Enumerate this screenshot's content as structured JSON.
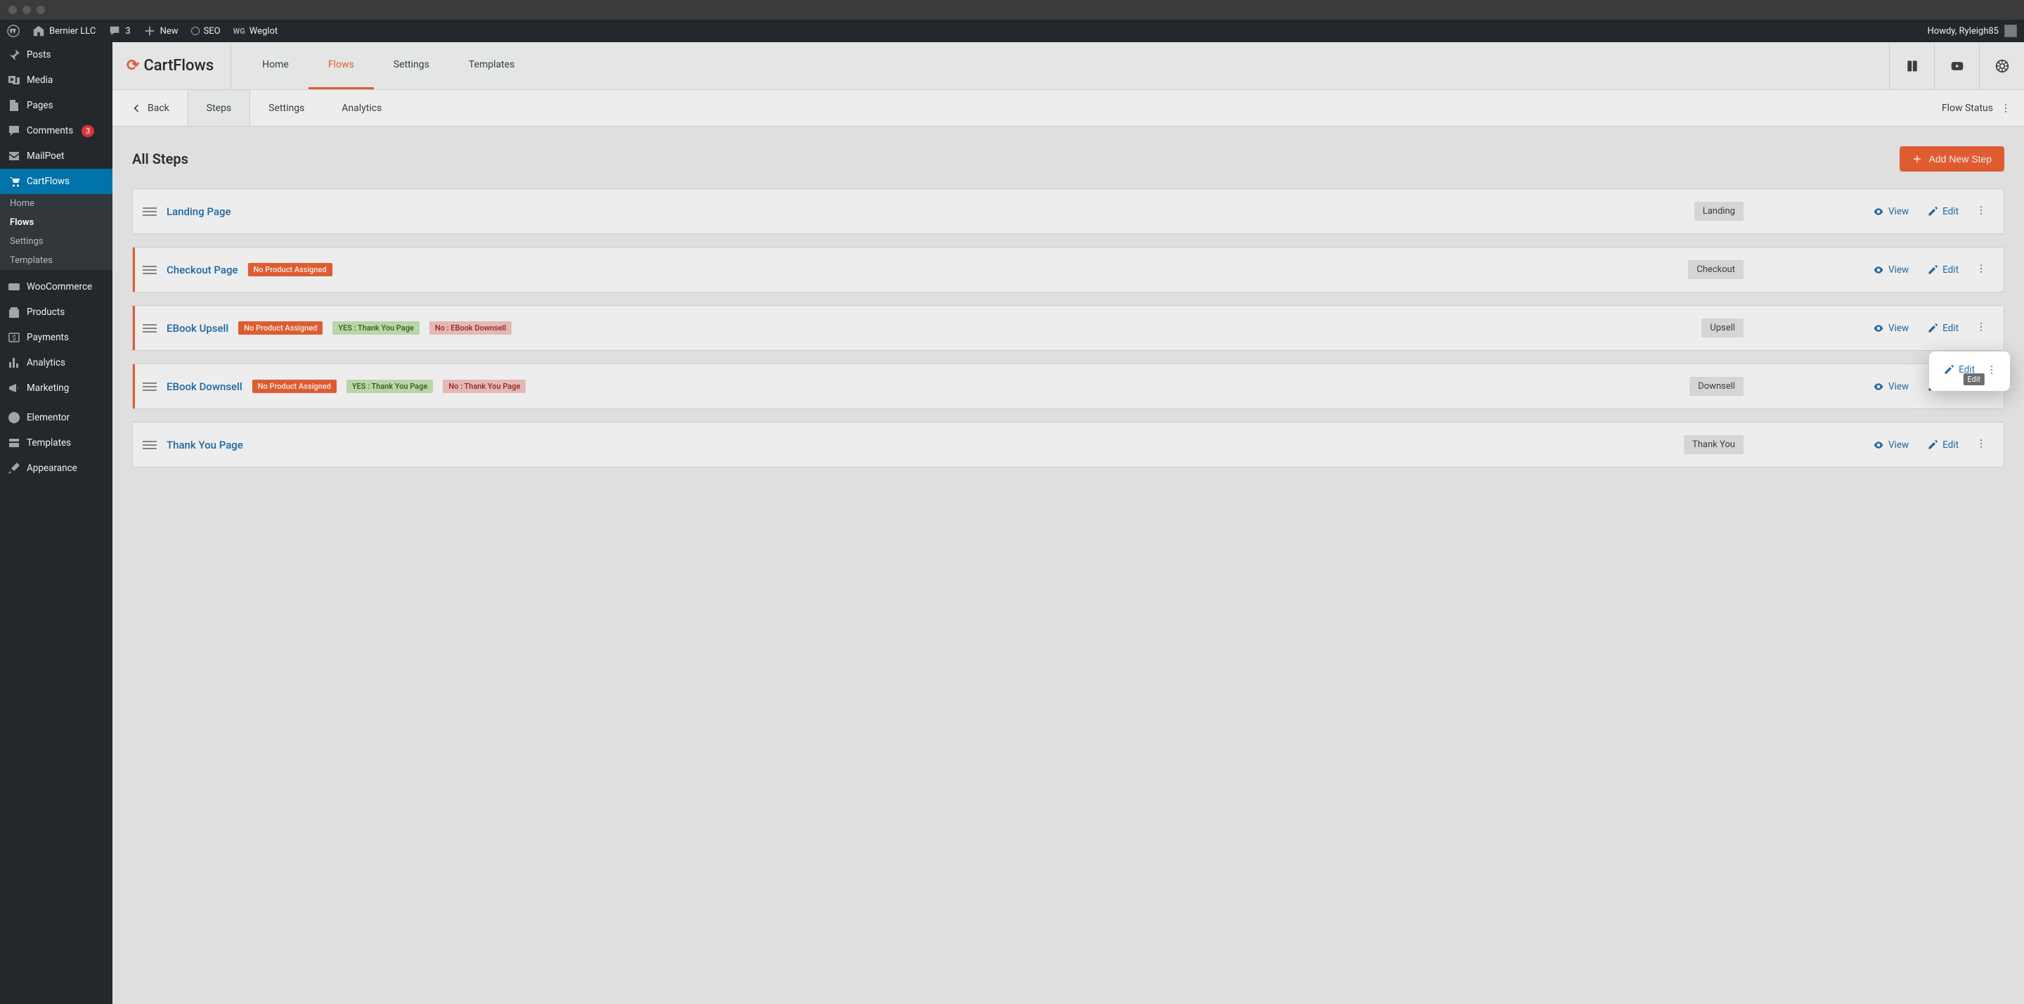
{
  "adminbar": {
    "site_name": "Bernier LLC",
    "comment_count": "3",
    "new_label": "New",
    "seo_label": "SEO",
    "weglot_label": "Weglot",
    "howdy": "Howdy, Ryleigh85"
  },
  "sidebar": {
    "items": [
      {
        "label": "Posts"
      },
      {
        "label": "Media"
      },
      {
        "label": "Pages"
      },
      {
        "label": "Comments",
        "badge": "3"
      },
      {
        "label": "MailPoet"
      },
      {
        "label": "CartFlows"
      },
      {
        "label": "WooCommerce"
      },
      {
        "label": "Products"
      },
      {
        "label": "Payments"
      },
      {
        "label": "Analytics"
      },
      {
        "label": "Marketing"
      },
      {
        "label": "Elementor"
      },
      {
        "label": "Templates"
      },
      {
        "label": "Appearance"
      }
    ],
    "submenu": [
      {
        "label": "Home"
      },
      {
        "label": "Flows"
      },
      {
        "label": "Settings"
      },
      {
        "label": "Templates"
      }
    ]
  },
  "topnav": {
    "brand": "CartFlows",
    "tabs": [
      {
        "label": "Home"
      },
      {
        "label": "Flows"
      },
      {
        "label": "Settings"
      },
      {
        "label": "Templates"
      }
    ]
  },
  "subnav": {
    "back_label": "Back",
    "tabs": [
      {
        "label": "Steps"
      },
      {
        "label": "Settings"
      },
      {
        "label": "Analytics"
      }
    ],
    "flow_status_label": "Flow Status"
  },
  "content": {
    "page_title": "All Steps",
    "add_step_label": "Add New Step",
    "view_label": "View",
    "edit_label": "Edit",
    "tooltip_edit": "Edit"
  },
  "steps": [
    {
      "name": "Landing Page",
      "chip": "Landing",
      "accent": false,
      "tags": []
    },
    {
      "name": "Checkout Page",
      "chip": "Checkout",
      "accent": true,
      "tags": [
        {
          "text": "No Product Assigned",
          "kind": "orange"
        }
      ]
    },
    {
      "name": "EBook Upsell",
      "chip": "Upsell",
      "accent": true,
      "tags": [
        {
          "text": "No Product Assigned",
          "kind": "orange"
        },
        {
          "text": "YES : Thank You Page",
          "kind": "green"
        },
        {
          "text": "No : EBook Downsell",
          "kind": "red"
        }
      ]
    },
    {
      "name": "EBook Downsell",
      "chip": "Downsell",
      "accent": true,
      "tags": [
        {
          "text": "No Product Assigned",
          "kind": "orange"
        },
        {
          "text": "YES : Thank You Page",
          "kind": "green"
        },
        {
          "text": "No : Thank You Page",
          "kind": "red"
        }
      ]
    },
    {
      "name": "Thank You Page",
      "chip": "Thank You",
      "accent": false,
      "tags": []
    }
  ]
}
